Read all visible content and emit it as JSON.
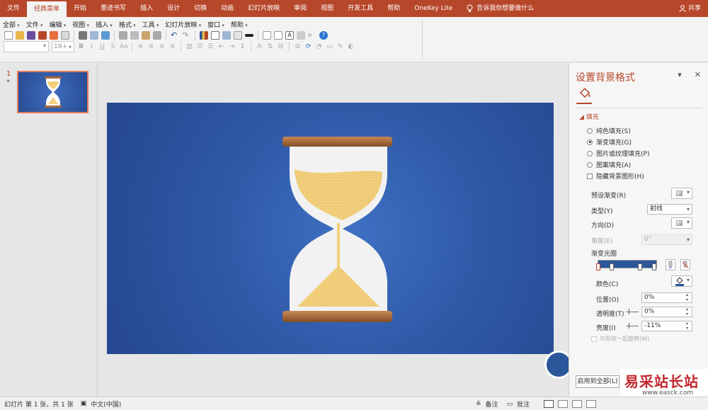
{
  "ribbon": {
    "tabs": [
      "文件",
      "经典菜单",
      "开始",
      "墨迹书写",
      "插入",
      "设计",
      "切换",
      "动画",
      "幻灯片放映",
      "审阅",
      "视图",
      "开发工具",
      "帮助",
      "OneKey Lite"
    ],
    "active_tab": "经典菜单",
    "tell_me": "告诉我你想要做什么",
    "share": "共享",
    "accent_color": "#b7472a"
  },
  "classic_menu": {
    "items": [
      "全部",
      "文件",
      "编辑",
      "视图",
      "插入",
      "格式",
      "工具",
      "幻灯片放映",
      "窗口",
      "帮助"
    ]
  },
  "font": {
    "name": "",
    "size_placeholder": "18+"
  },
  "thumbnails": {
    "slide_number": "1",
    "marker": "*"
  },
  "format_pane": {
    "title": "设置背景格式",
    "section": "填充",
    "fill_options": {
      "solid": "纯色填充(S)",
      "gradient": "渐变填充(G)",
      "picture": "图片或纹理填充(P)",
      "pattern": "图案填充(A)"
    },
    "selected_fill": "gradient",
    "hide_background": "隐藏背景图形(H)",
    "preset_gradient": "预设渐变(R)",
    "type_label": "类型(Y)",
    "type_value": "射线",
    "direction_label": "方向(D)",
    "angle_label": "角度(E)",
    "angle_value": "0°",
    "gradient_stops_label": "渐变光圈",
    "color_label": "颜色(C)",
    "position_label": "位置(O)",
    "position_value": "0%",
    "transparency_label": "透明度(T)",
    "transparency_value": "0%",
    "brightness_label": "亮度(I)",
    "brightness_value": "-11%",
    "rotate_with_shape": "与形状一起旋转(W)",
    "apply_all": "启用到全部(L)"
  },
  "slide": {
    "background_colors": [
      "#3f70c2",
      "#2f5aa8",
      "#25478e"
    ],
    "sand_color": "#f2cf7c",
    "wood_color": "#a86b3c"
  },
  "statusbar": {
    "slide_info": "幻灯片 第 1 张，共 1 张",
    "language": "中文(中国)",
    "notes": "备注",
    "comments": "批注"
  },
  "watermark": {
    "brand": "易采站长站",
    "url": "www.easck.com"
  }
}
